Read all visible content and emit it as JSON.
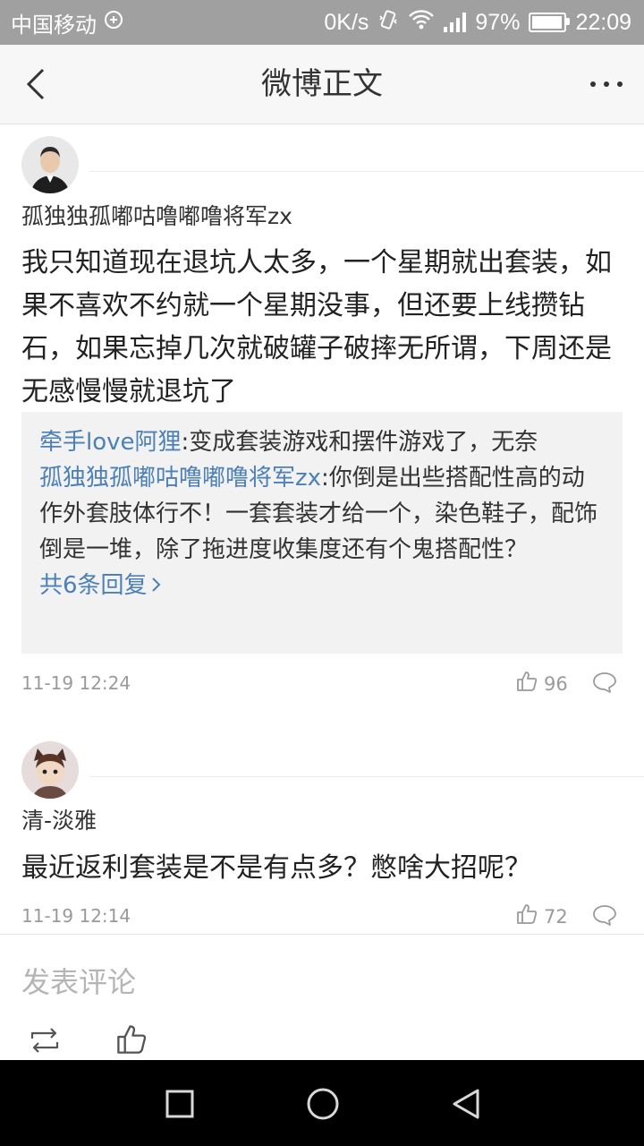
{
  "status_bar": {
    "carrier": "中国移动",
    "net_speed": "0K/s",
    "battery": "97%",
    "battery_level": 0.97,
    "time": "22:09"
  },
  "nav": {
    "title": "微博正文"
  },
  "comments": [
    {
      "username": "孤独独孤嘟咕噜嘟噜将军zx",
      "text": "我只知道现在退坑人太多，一个星期就出套装，如果不喜欢不约就一个星期没事，但还要上线攒钻石，如果忘掉几次就破罐子破摔无所谓，下周还是无感慢慢就退坑了",
      "replies": [
        {
          "user": "牵手love阿狸",
          "text": ":变成套装游戏和摆件游戏了，无奈"
        },
        {
          "user": "孤独独孤嘟咕噜嘟噜将军zx",
          "text": ":你倒是出些搭配性高的动作外套肢体行不！一套套装才给一个，染色鞋子，配饰倒是一堆，除了拖进度收集度还有个鬼搭配性？"
        }
      ],
      "more_replies": "共6条回复",
      "time": "11-19 12:24",
      "likes": "96"
    },
    {
      "username": "清-淡雅",
      "text": "最近返利套装是不是有点多？憋啥大招呢？",
      "time": "11-19 12:14",
      "likes": "72"
    }
  ],
  "compose": {
    "placeholder": "发表评论"
  },
  "colors": {
    "link": "#4c80b6",
    "status_bar": "#a0a0a0",
    "nav_bg": "#f7f7f7"
  }
}
